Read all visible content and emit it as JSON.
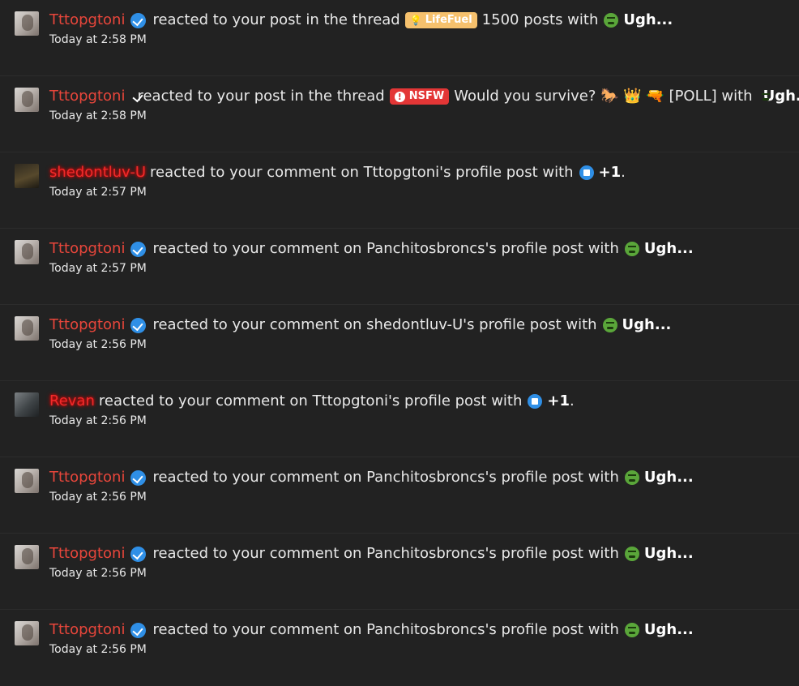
{
  "notifications": [
    {
      "avatar": "t",
      "user": "Tttopgtoni",
      "user_style": "normal",
      "verified": true,
      "action": "reacted to your post in the thread",
      "prefix": {
        "label": "LifeFuel",
        "type": "lifefuel",
        "icon": "lightbulb-icon"
      },
      "title": "1500 posts with",
      "reaction": {
        "type": "sick",
        "label": "Ugh..."
      },
      "time": "Today at 2:58 PM"
    },
    {
      "avatar": "t",
      "user": "Tttopgtoni",
      "user_style": "normal",
      "verified": true,
      "action": "reacted to your post in the thread",
      "prefix": {
        "label": "NSFW",
        "type": "nsfw",
        "icon": "alert-icon"
      },
      "title": "Would you survive? 🐎 👑 🔫 [POLL] with",
      "reaction": {
        "type": "sick",
        "label": "Ugh..."
      },
      "time": "Today at 2:58 PM"
    },
    {
      "avatar": "s",
      "user": "shedontluv-U",
      "user_style": "glow",
      "verified": false,
      "action": "reacted to your comment on Tttopgtoni's profile post with",
      "reaction": {
        "type": "like",
        "label": "+1"
      },
      "end": ".",
      "time": "Today at 2:57 PM"
    },
    {
      "avatar": "t",
      "user": "Tttopgtoni",
      "user_style": "normal",
      "verified": true,
      "action": "reacted to your comment on Panchitosbroncs's profile post with",
      "reaction": {
        "type": "sick",
        "label": "Ugh..."
      },
      "time": "Today at 2:57 PM"
    },
    {
      "avatar": "t",
      "user": "Tttopgtoni",
      "user_style": "normal",
      "verified": true,
      "action": "reacted to your comment on shedontluv-U's profile post with",
      "reaction": {
        "type": "sick",
        "label": "Ugh..."
      },
      "time": "Today at 2:56 PM"
    },
    {
      "avatar": "r",
      "user": "Revan",
      "user_style": "glow",
      "verified": false,
      "action": "reacted to your comment on Tttopgtoni's profile post with",
      "reaction": {
        "type": "like",
        "label": "+1"
      },
      "end": ".",
      "time": "Today at 2:56 PM"
    },
    {
      "avatar": "t",
      "user": "Tttopgtoni",
      "user_style": "normal",
      "verified": true,
      "action": "reacted to your comment on Panchitosbroncs's profile post with",
      "reaction": {
        "type": "sick",
        "label": "Ugh..."
      },
      "time": "Today at 2:56 PM"
    },
    {
      "avatar": "t",
      "user": "Tttopgtoni",
      "user_style": "normal",
      "verified": true,
      "action": "reacted to your comment on Panchitosbroncs's profile post with",
      "reaction": {
        "type": "sick",
        "label": "Ugh..."
      },
      "time": "Today at 2:56 PM"
    },
    {
      "avatar": "t",
      "user": "Tttopgtoni",
      "user_style": "normal",
      "verified": true,
      "action": "reacted to your comment on Panchitosbroncs's profile post with",
      "reaction": {
        "type": "sick",
        "label": "Ugh..."
      },
      "time": "Today at 2:56 PM"
    }
  ],
  "colors": {
    "background": "#222222",
    "username": "#e8463b",
    "verified": "#2f8fe6",
    "lifefuel": "#f6c16d",
    "nsfw": "#e33636"
  }
}
